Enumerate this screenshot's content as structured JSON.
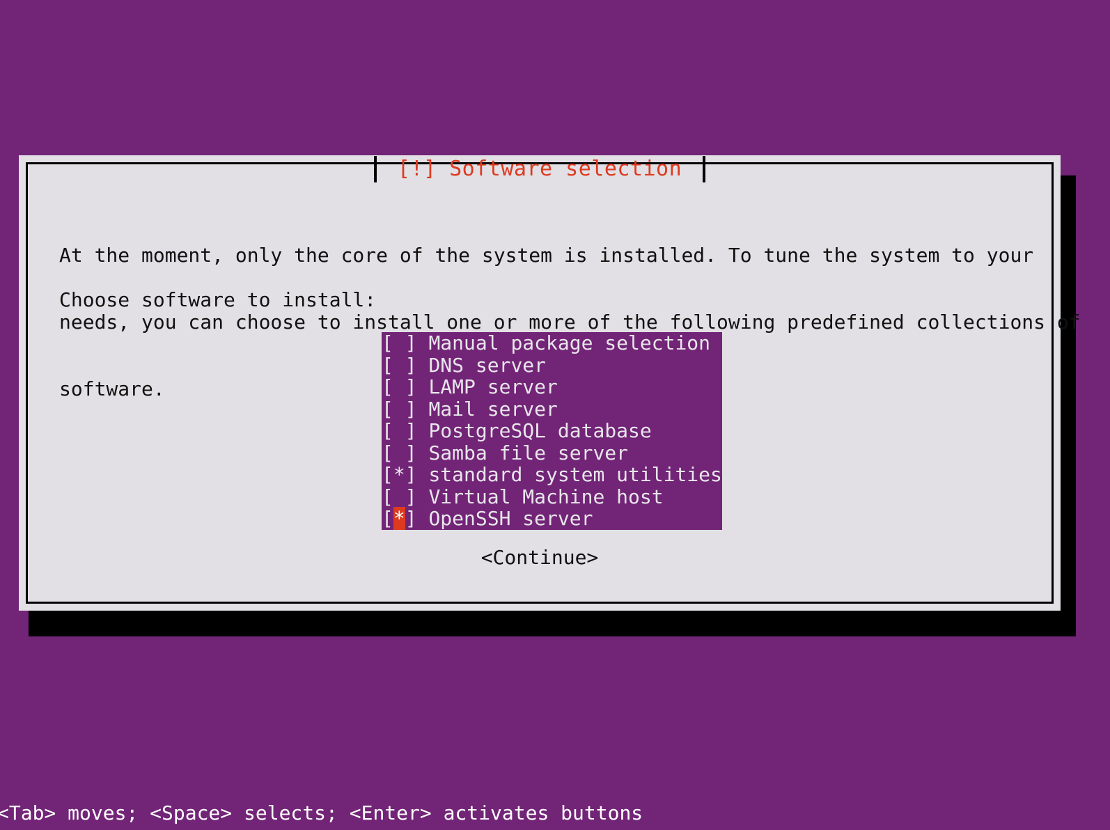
{
  "screen": {
    "background_color": "#722477",
    "shadow_color": "#000000"
  },
  "dialog": {
    "title": "[!] Software selection",
    "title_color": "#DD3A20",
    "background_color": "#E2E0E4",
    "border_color": "#000000",
    "paragraph_line1": "At the moment, only the core of the system is installed. To tune the system to your",
    "paragraph_line2": "needs, you can choose to install one or more of the following predefined collections of",
    "paragraph_line3": "software.",
    "prompt": "Choose software to install:"
  },
  "software_list": {
    "background_color": "#722477",
    "text_color": "#E8E6EA",
    "cursor_color": "#DD3A20",
    "checked_marker": "[*]",
    "unchecked_marker": "[ ]",
    "items": [
      {
        "label": "Manual package selection",
        "checked": false,
        "focused": false
      },
      {
        "label": "DNS server",
        "checked": false,
        "focused": false
      },
      {
        "label": "LAMP server",
        "checked": false,
        "focused": false
      },
      {
        "label": "Mail server",
        "checked": false,
        "focused": false
      },
      {
        "label": "PostgreSQL database",
        "checked": false,
        "focused": false
      },
      {
        "label": "Samba file server",
        "checked": false,
        "focused": false
      },
      {
        "label": "standard system utilities",
        "checked": true,
        "focused": false
      },
      {
        "label": "Virtual Machine host",
        "checked": false,
        "focused": false
      },
      {
        "label": "OpenSSH server",
        "checked": true,
        "focused": true
      }
    ]
  },
  "buttons": {
    "continue_label": "<Continue>"
  },
  "status_bar": {
    "hint": "<Tab> moves; <Space> selects; <Enter> activates buttons",
    "text_color": "#FFFFFF"
  }
}
